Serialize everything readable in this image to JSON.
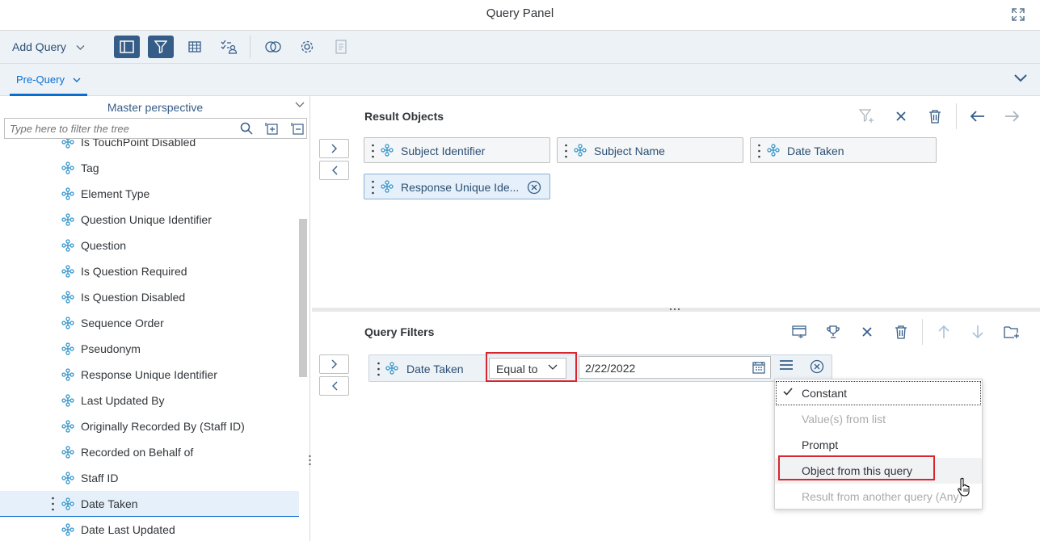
{
  "window": {
    "title": "Query Panel"
  },
  "toolbar": {
    "add_query_label": "Add Query"
  },
  "tabs": [
    {
      "label": "Pre-Query"
    }
  ],
  "left_panel": {
    "perspective": "Master perspective",
    "filter_placeholder": "Type here to filter the tree",
    "tree_items": [
      {
        "label": "Is TouchPoint Disabled"
      },
      {
        "label": "Tag"
      },
      {
        "label": "Element Type"
      },
      {
        "label": "Question Unique Identifier"
      },
      {
        "label": "Question"
      },
      {
        "label": "Is Question Required"
      },
      {
        "label": "Is Question Disabled"
      },
      {
        "label": "Sequence Order"
      },
      {
        "label": "Pseudonym"
      },
      {
        "label": "Response Unique Identifier"
      },
      {
        "label": "Last Updated By"
      },
      {
        "label": "Originally Recorded By (Staff ID)"
      },
      {
        "label": "Recorded on Behalf of"
      },
      {
        "label": "Staff ID"
      },
      {
        "label": "Date Taken",
        "selected": true
      },
      {
        "label": "Date Last Updated"
      }
    ]
  },
  "result_objects": {
    "title": "Result Objects",
    "chips": [
      {
        "label": "Subject Identifier"
      },
      {
        "label": "Subject Name"
      },
      {
        "label": "Date Taken"
      },
      {
        "label": "Response Unique Ide..."
      }
    ]
  },
  "query_filters": {
    "title": "Query Filters",
    "filter": {
      "object": "Date Taken",
      "operator": "Equal to",
      "value": "2/22/2022"
    },
    "operand_menu": [
      {
        "label": "Constant",
        "checked": true,
        "disabled": false
      },
      {
        "label": "Value(s) from list",
        "checked": false,
        "disabled": true
      },
      {
        "label": "Prompt",
        "checked": false,
        "disabled": false
      },
      {
        "label": "Object from this query",
        "checked": false,
        "disabled": false
      },
      {
        "label": "Result from another query (Any)",
        "checked": false,
        "disabled": true
      }
    ]
  },
  "colors": {
    "accent": "#0a6ed1",
    "toolbar_bg": "#edf2f7",
    "active_button": "#355d87",
    "highlight_box": "#d9262d"
  }
}
